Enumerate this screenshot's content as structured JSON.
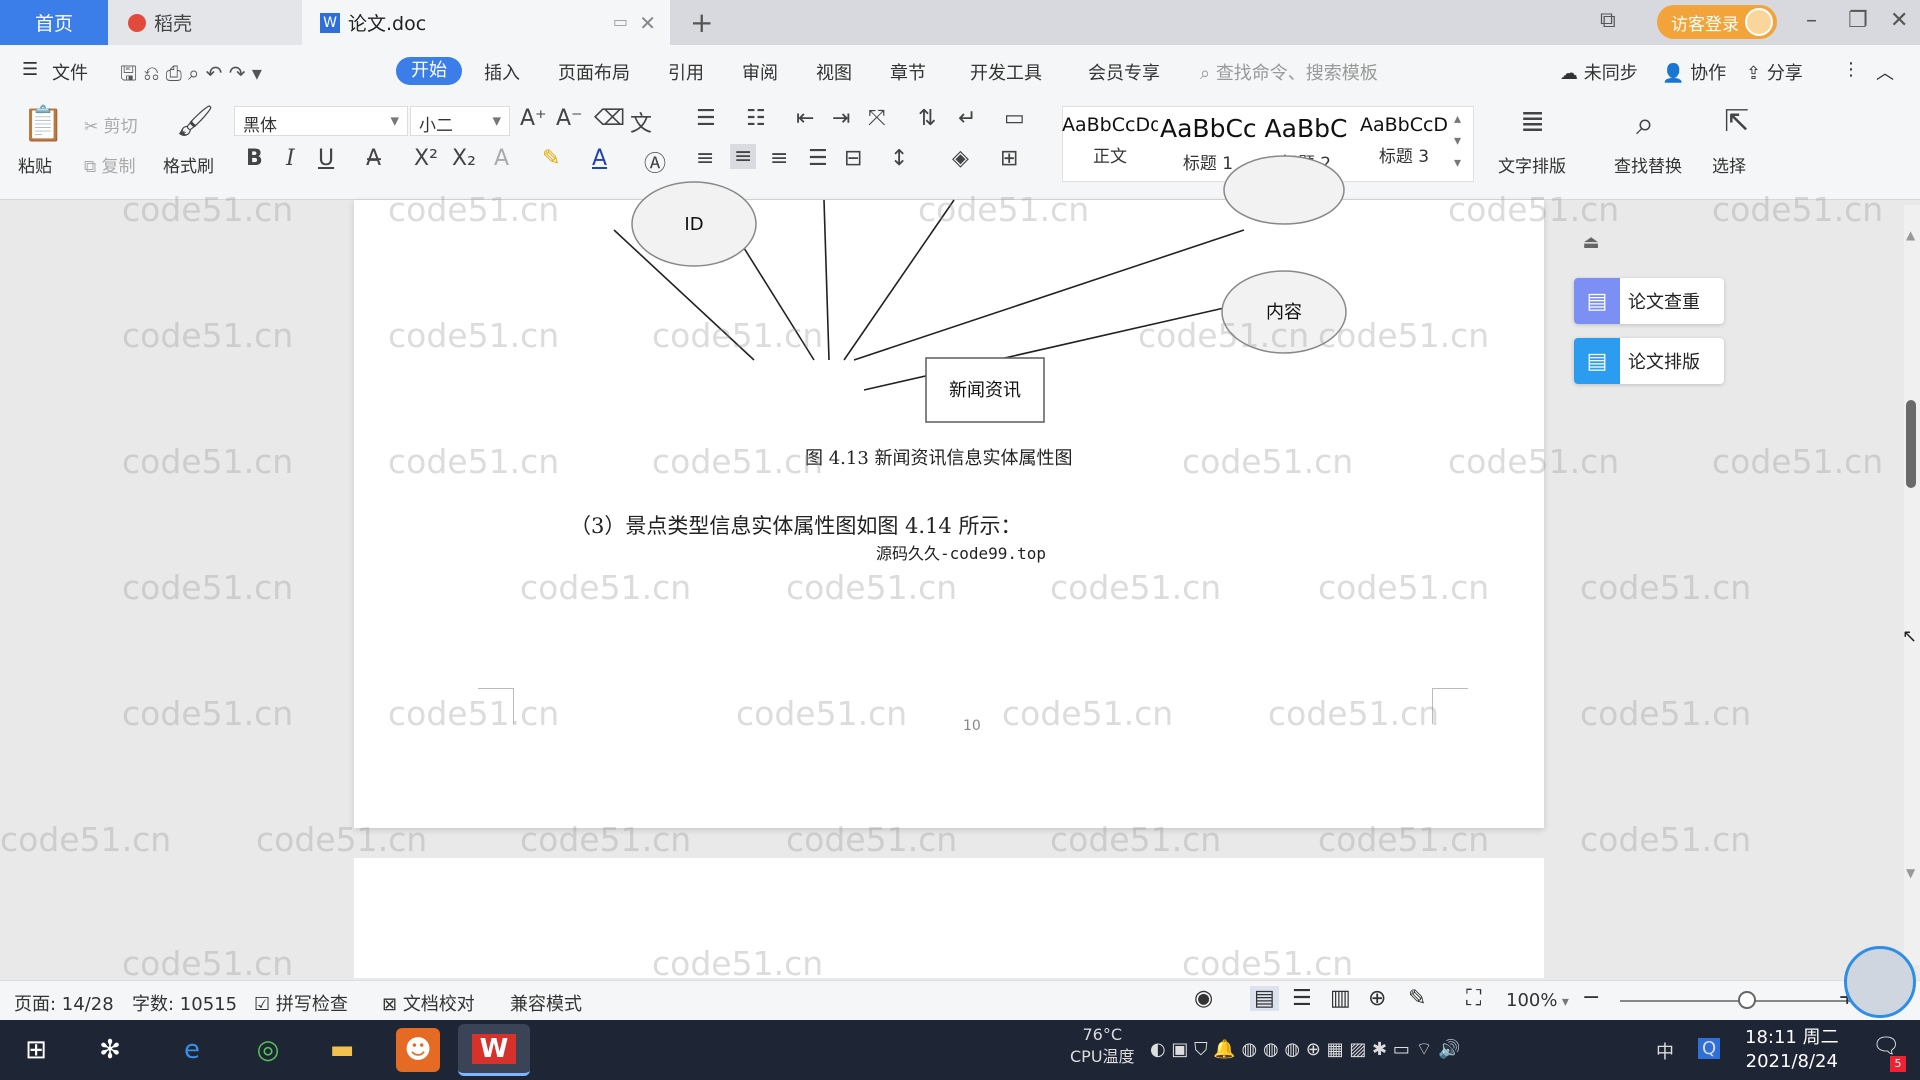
{
  "tabs": {
    "home": "首页",
    "docer": "稻壳",
    "doc": "论文.doc",
    "add": "+"
  },
  "titlebar": {
    "login": "访客登录"
  },
  "menu": {
    "file": "文件",
    "items": [
      "开始",
      "插入",
      "页面布局",
      "引用",
      "审阅",
      "视图",
      "章节",
      "开发工具",
      "会员专享"
    ],
    "search_placeholder": "查找命令、搜索模板",
    "right": [
      "未同步",
      "协作",
      "分享"
    ]
  },
  "ribbon": {
    "paste": "粘贴",
    "cut": "剪切",
    "copy": "复制",
    "format_painter": "格式刷",
    "font_name": "黑体",
    "font_size": "小二",
    "styles": [
      {
        "sample": "AaBbCcDd",
        "name": "正文"
      },
      {
        "sample": "AaBbCc",
        "name": "标题 1"
      },
      {
        "sample": "AaBbC",
        "name": "标题 2"
      },
      {
        "sample": "AaBbCcD",
        "name": "标题 3"
      }
    ],
    "text_layout": "文字排版",
    "find_replace": "查找替换",
    "select": "选择"
  },
  "document": {
    "entity": "新闻资讯",
    "attr_id": "ID",
    "attr_content": "内容",
    "caption": "图 4.13   新闻资讯信息实体属性图",
    "paragraph": "（3）景点类型信息实体属性图如图 4.14 所示：",
    "source": "源码久久-code99.top",
    "page_number": "10"
  },
  "side_panel": {
    "check": "论文查重",
    "format": "论文排版"
  },
  "watermark": "code51.cn",
  "status": {
    "page": "页面: 14/28",
    "words": "字数: 10515",
    "spell": "拼写检查",
    "proof": "文档校对",
    "compat": "兼容模式",
    "zoom": "100%",
    "zoom_level": 0.55
  },
  "taskbar": {
    "temp": "76°C",
    "cpu": "CPU温度",
    "time": "18:11 周二",
    "date": "2021/8/24",
    "ime": "中",
    "notify_count": "5"
  }
}
